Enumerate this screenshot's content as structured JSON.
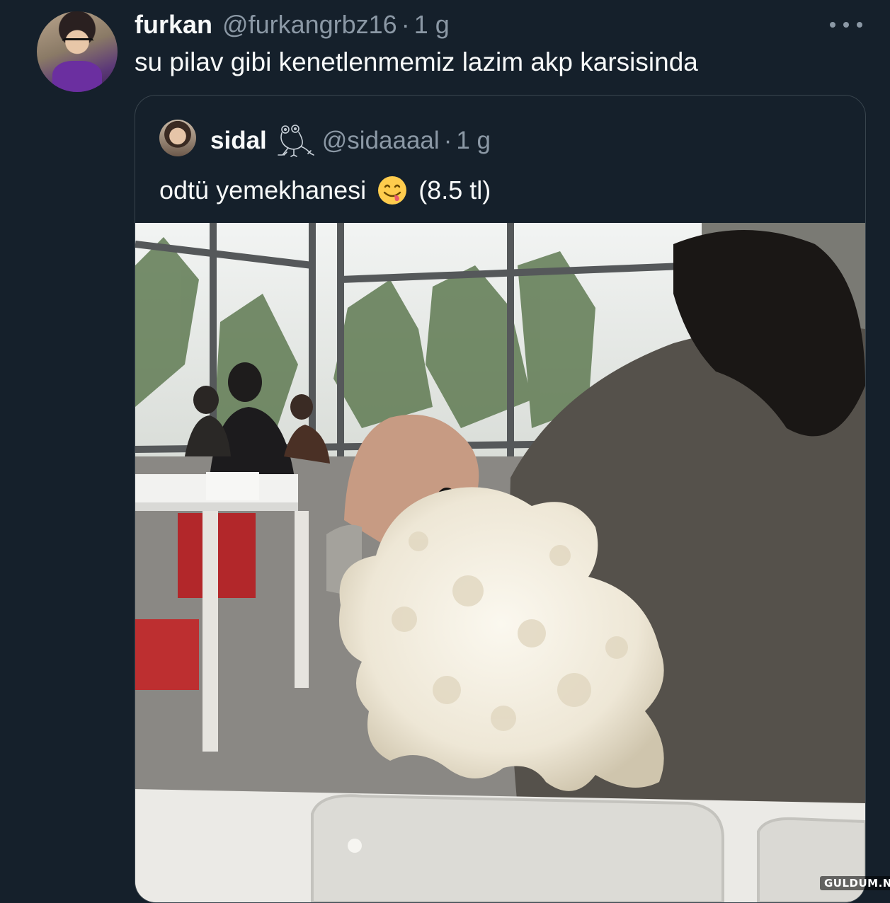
{
  "tweet": {
    "author_name": "furkan",
    "author_handle": "@furkangrbz16",
    "separator": "·",
    "time": "1 g",
    "text": "su pilav gibi kenetlenmemiz lazim akp karsisinda",
    "more_icon": "ellipsis-icon"
  },
  "quote": {
    "author_name": "sidal",
    "name_icon": "frog-icon",
    "author_handle": "@sidaaaal",
    "separator": "·",
    "time": "1 g",
    "text_before": "odtü yemekhanesi",
    "emoji": "face-savoring-food-icon",
    "text_after": "(8.5 tl)"
  },
  "watermark": "GULDUM.NET",
  "colors": {
    "background": "#15202b",
    "primary_text": "#f7f9f9",
    "secondary_text": "#8b98a5",
    "border": "#38444d"
  }
}
